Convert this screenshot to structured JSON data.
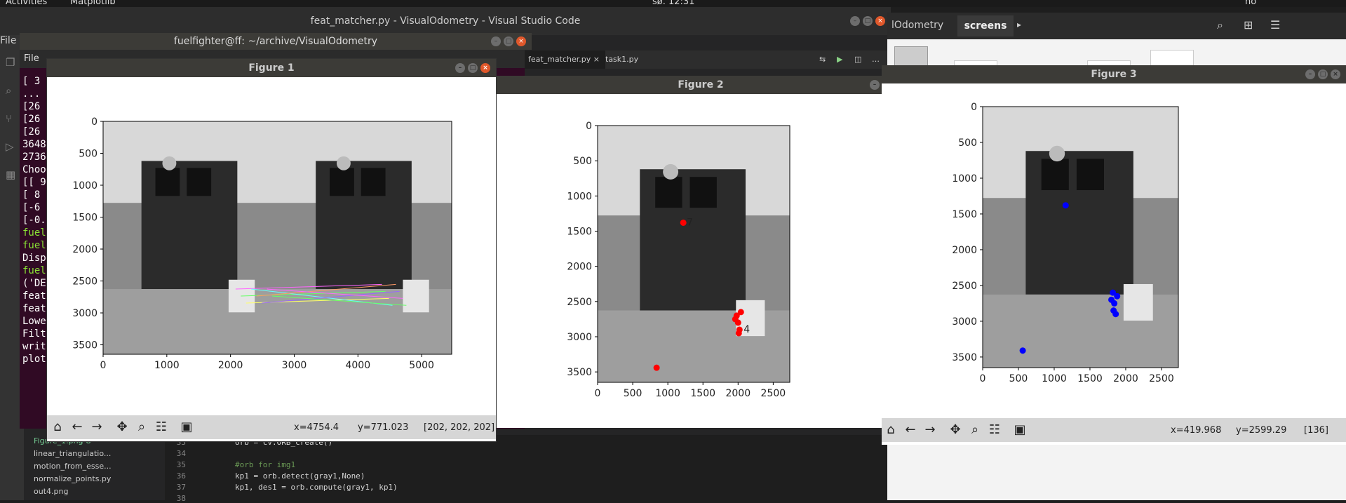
{
  "topbar": {
    "activities": "Activities",
    "app": "Matplotlib",
    "clock": "sø. 12:31",
    "lang": "no"
  },
  "vscode": {
    "title": "feat_matcher.py - VisualOdometry - Visual Studio Code",
    "file_menu": "File",
    "tabs": [
      "feat_matcher.py",
      "task1.py"
    ],
    "explorer": [
      "Figure_1.png",
      "linear_triangulatio...",
      "motion_from_esse...",
      "normalize_points.py",
      "out4.png"
    ],
    "explorer_badge": "U",
    "code": [
      {
        "n": "33",
        "t": "orb = cv.ORB_create()"
      },
      {
        "n": "34",
        "t": ""
      },
      {
        "n": "35",
        "t": "#orb for img1"
      },
      {
        "n": "36",
        "t": "kp1 = orb.detect(gray1,None)"
      },
      {
        "n": "37",
        "t": "kp1, des1 = orb.compute(gray1, kp1)"
      },
      {
        "n": "38",
        "t": ""
      }
    ]
  },
  "terminal": {
    "title": "fuelfighter@ff: ~/archive/VisualOdometry",
    "menu": "File",
    "lines": [
      "[ 3",
      " ...",
      " [26",
      " [26",
      " [26",
      "3648",
      "2736",
      "Choo",
      "[[ 9",
      " [ 8",
      " [-6",
      "[-0.",
      "fuel",
      "fuel",
      "Disp",
      "fuel",
      "('DE",
      "feat",
      "feat",
      "Lowe",
      "Filt",
      "writ",
      "plot"
    ]
  },
  "screens": {
    "tab1": "lOdometry",
    "tab2": "screens"
  },
  "figure1": {
    "title": "Figure 1",
    "x_ticks": [
      "0",
      "1000",
      "2000",
      "3000",
      "4000",
      "5000"
    ],
    "y_ticks": [
      "0",
      "500",
      "1000",
      "1500",
      "2000",
      "2500",
      "3000",
      "3500"
    ],
    "status": {
      "x": "x=4754.4",
      "y": "y=771.023",
      "rgb": "[202, 202, 202]"
    }
  },
  "figure2": {
    "title": "Figure 2",
    "x_ticks": [
      "0",
      "500",
      "1000",
      "1500",
      "2000",
      "2500"
    ],
    "y_ticks": [
      "0",
      "500",
      "1000",
      "1500",
      "2000",
      "2500",
      "3000",
      "3500"
    ],
    "point_labels": [
      "7",
      "4"
    ]
  },
  "figure3": {
    "title": "Figure 3",
    "x_ticks": [
      "0",
      "500",
      "1000",
      "1500",
      "2000",
      "2500"
    ],
    "y_ticks": [
      "0",
      "500",
      "1000",
      "1500",
      "2000",
      "2500",
      "3000",
      "3500"
    ],
    "status": {
      "x": "x=419.968",
      "y": "y=2599.29",
      "rgb": "[136]"
    }
  },
  "colors": {
    "accent": "#e0582b",
    "points_fig2": "#ff0000",
    "points_fig3": "#0000ff"
  }
}
